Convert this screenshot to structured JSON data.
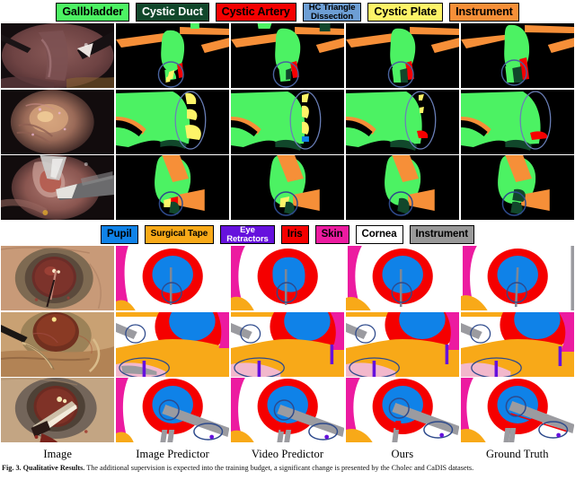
{
  "figure": {
    "caption_label": "Fig. 3.",
    "caption_title": "Qualitative Results.",
    "caption_text": " The additional supervision is expected into the training budget, a significant change is presented by the Cholec and CaDIS datasets."
  },
  "legends": [
    {
      "id": "cholec-legend",
      "items": [
        {
          "label": "Gallbladder",
          "fill": "#4cf263",
          "text": "#000000"
        },
        {
          "label": "Cystic Duct",
          "fill": "#11472b",
          "text": "#ffffff"
        },
        {
          "label": "Cystic Artery",
          "fill": "#f50000",
          "text": "#000000"
        },
        {
          "label": "HC Triangle\nDissection",
          "fill": "#6d9ed4",
          "text": "#000000",
          "two_line": true
        },
        {
          "label": "Cystic Plate",
          "fill": "#fdf468",
          "text": "#000000"
        },
        {
          "label": "Instrument",
          "fill": "#f68f38",
          "text": "#000000"
        }
      ]
    },
    {
      "id": "cadis-legend",
      "items": [
        {
          "label": "Pupil",
          "fill": "#0f82e8",
          "text": "#000000"
        },
        {
          "label": "Surgical Tape",
          "fill": "#f8a918",
          "text": "#000000"
        },
        {
          "label": "Eye\nRetractors",
          "fill": "#6611dd",
          "text": "#ffffff",
          "two_line": true
        },
        {
          "label": "Iris",
          "fill": "#f50000",
          "text": "#000000"
        },
        {
          "label": "Skin",
          "fill": "#ec1ba0",
          "text": "#000000"
        },
        {
          "label": "Cornea",
          "fill": "#ffffff",
          "text": "#000000"
        },
        {
          "label": "Instrument",
          "fill": "#999999",
          "text": "#000000"
        }
      ]
    }
  ],
  "columns": [
    {
      "label": "Image"
    },
    {
      "label": "Image Predictor"
    },
    {
      "label": "Video Predictor"
    },
    {
      "label": "Ours"
    },
    {
      "label": "Ground Truth"
    }
  ],
  "colors": {
    "gallbladder": "#4cf263",
    "cystic_duct": "#11472b",
    "cystic_artery": "#f50000",
    "hc_triangle": "#6d9ed4",
    "cystic_plate": "#fdf468",
    "instrument_orange": "#f68f38",
    "pupil": "#0f82e8",
    "surgical_tape": "#f8a918",
    "eye_retractors": "#6611dd",
    "iris": "#f50000",
    "skin": "#ec1ba0",
    "cornea": "#ffffff",
    "instrument_grey": "#999999",
    "highlight_circle": "#2e4a8c",
    "background_black": "#000000",
    "background_white": "#ffffff"
  },
  "datasets": {
    "cholec": {
      "rows": 3,
      "name": "Cholec"
    },
    "cadis": {
      "rows": 3,
      "name": "CaDIS"
    }
  }
}
